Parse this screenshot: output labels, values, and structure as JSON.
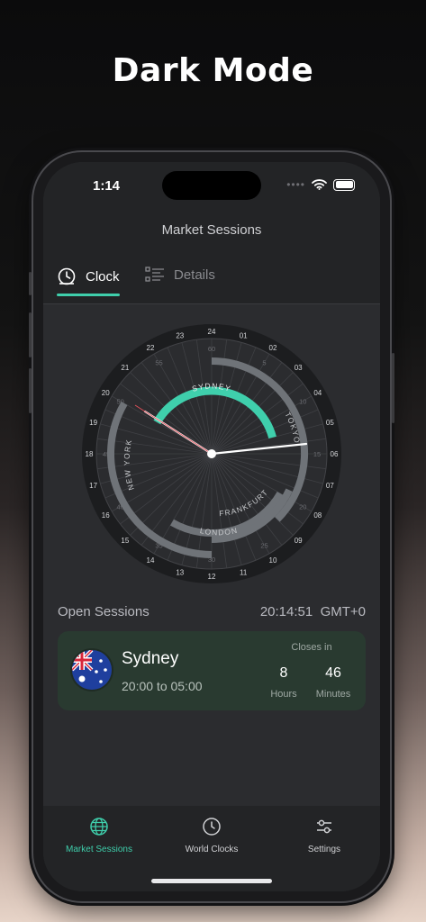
{
  "headline": "Dark Mode",
  "status": {
    "time": "1:14"
  },
  "nav": {
    "title": "Market Sessions"
  },
  "tabs": [
    {
      "label": "Clock",
      "icon": "clock-icon",
      "active": true
    },
    {
      "label": "Details",
      "icon": "list-icon",
      "active": false
    }
  ],
  "dial": {
    "hours": [
      "24",
      "01",
      "02",
      "03",
      "04",
      "05",
      "06",
      "07",
      "08",
      "09",
      "10",
      "11",
      "12",
      "13",
      "14",
      "15",
      "16",
      "17",
      "18",
      "19",
      "20",
      "21",
      "22",
      "23"
    ],
    "minutes": [
      "60",
      "5",
      "10",
      "15",
      "20",
      "25",
      "30",
      "35",
      "40",
      "45",
      "50",
      "55"
    ],
    "session_labels": [
      "SYDNEY",
      "TOKYO",
      "FRANKFURT",
      "LONDON",
      "NEW YORK"
    ],
    "active_color": "#3fcfac",
    "inactive_color": "#6f7378"
  },
  "open_sessions": {
    "title": "Open Sessions",
    "time": "20:14:51",
    "tz": "GMT+0"
  },
  "session_card": {
    "city": "Sydney",
    "hours": "20:00 to 05:00",
    "closes_label": "Closes in",
    "hours_value": "8",
    "hours_unit": "Hours",
    "minutes_value": "46",
    "minutes_unit": "Minutes"
  },
  "bottom_nav": [
    {
      "label": "Market Sessions",
      "icon": "globe-icon",
      "active": true
    },
    {
      "label": "World Clocks",
      "icon": "clock-icon",
      "active": false
    },
    {
      "label": "Settings",
      "icon": "sliders-icon",
      "active": false
    }
  ],
  "colors": {
    "accent": "#3fcfac",
    "card": "#293a30"
  }
}
